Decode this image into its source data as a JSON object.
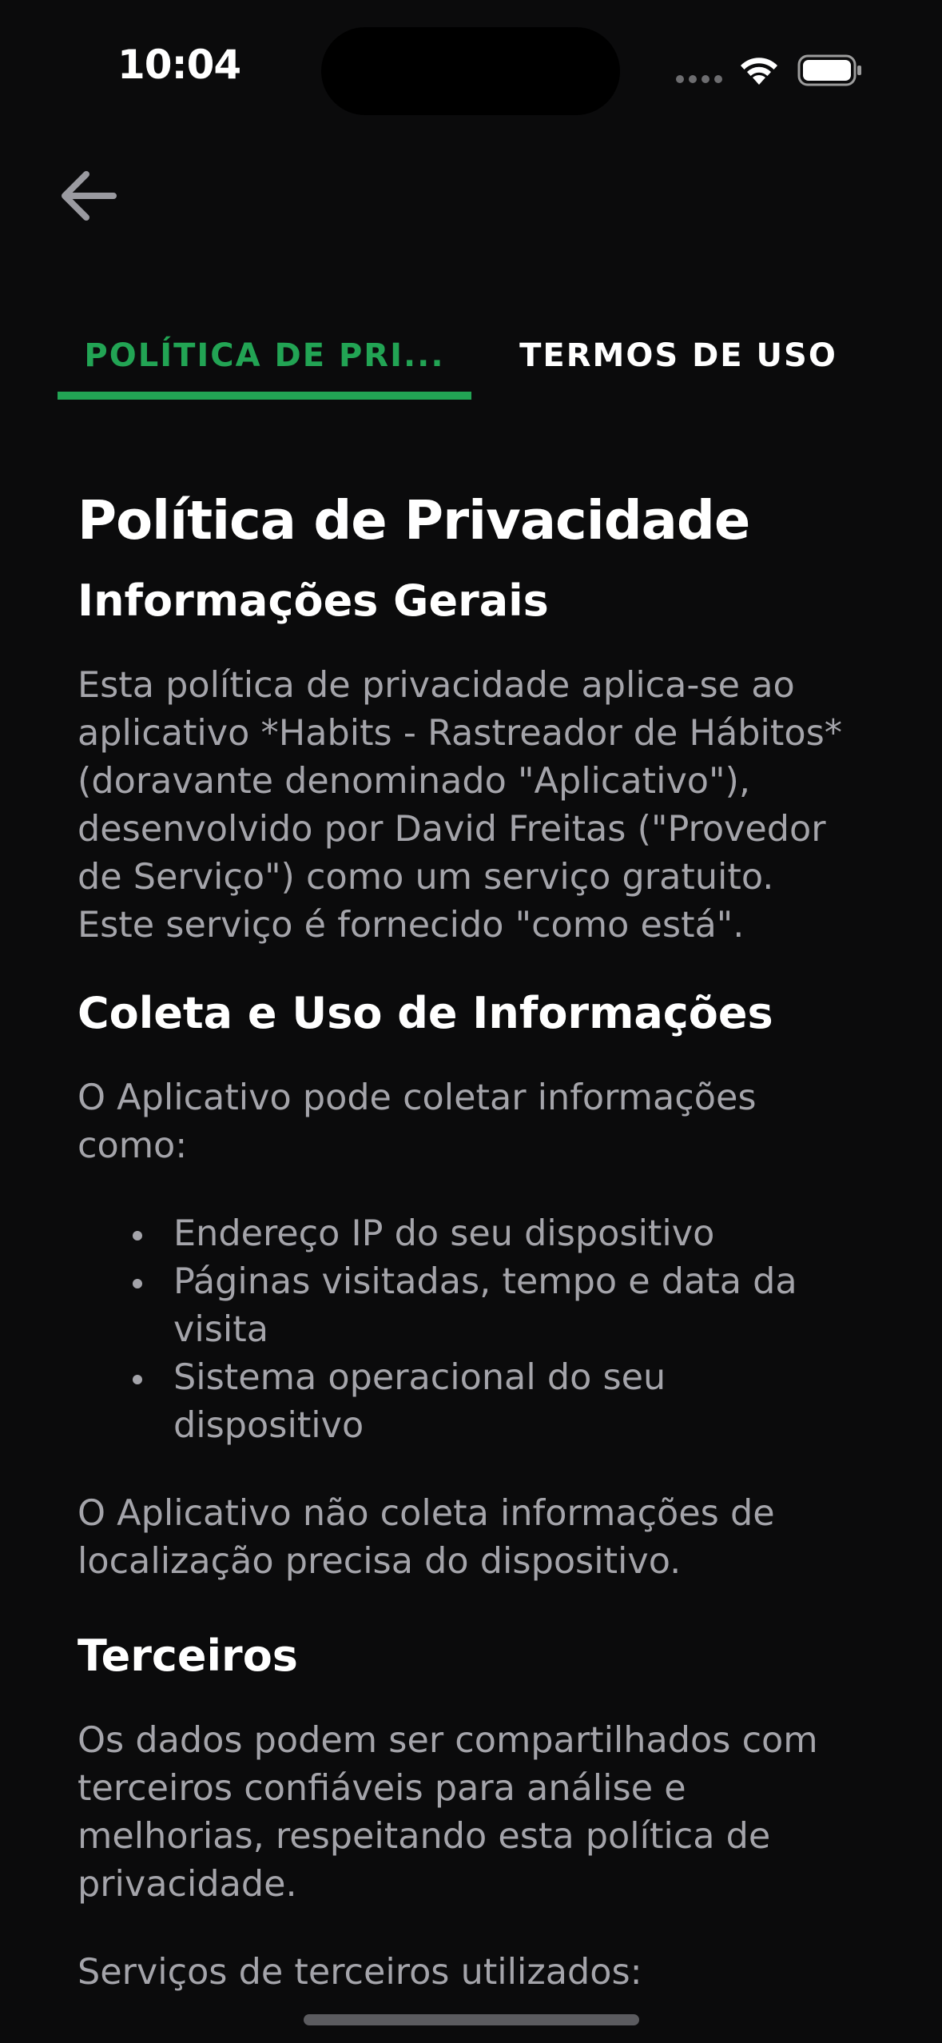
{
  "status_bar": {
    "time": "10:04",
    "icons": [
      "signal-dots-icon",
      "wifi-icon",
      "battery-icon"
    ]
  },
  "nav": {
    "back_icon": "arrow-left-icon"
  },
  "tabs": [
    {
      "label": "POLÍTICA DE PRI...",
      "active": true
    },
    {
      "label": "TERMOS DE USO",
      "active": false
    }
  ],
  "colors": {
    "accent": "#22a454",
    "background": "#0b0b0c",
    "body_text": "#a4a4aa",
    "heading_text": "#ffffff"
  },
  "content": {
    "title": "Política de Privacidade",
    "sections": {
      "info": {
        "heading": "Informações Gerais",
        "paragraph_lines": [
          "Esta política de privacidade aplica-se ao",
          "aplicativo *Habits - Rastreador de Hábitos*",
          "(doravante denominado \"Aplicativo\"),",
          "desenvolvido por David Freitas (\"Provedor",
          "de Serviço\") como um serviço gratuito.",
          "Este serviço é fornecido \"como está\"."
        ]
      },
      "coleta": {
        "heading": "Coleta e Uso de Informações",
        "intro_lines": [
          "O Aplicativo pode coletar informações",
          "como:"
        ],
        "items": [
          {
            "lines": [
              "Endereço IP do seu dispositivo"
            ]
          },
          {
            "lines": [
              "Páginas visitadas, tempo e data da",
              "visita"
            ]
          },
          {
            "lines": [
              "Sistema operacional do seu",
              "dispositivo"
            ]
          }
        ],
        "outro_lines": [
          "O Aplicativo não coleta informações de",
          "localização precisa do dispositivo."
        ]
      },
      "terceiros": {
        "heading": "Terceiros",
        "paragraph_lines": [
          "Os dados podem ser compartilhados com",
          "terceiros confiáveis para análise e",
          "melhorias, respeitando esta política de",
          "privacidade."
        ],
        "servicos": "Serviços de terceiros utilizados:"
      }
    }
  }
}
